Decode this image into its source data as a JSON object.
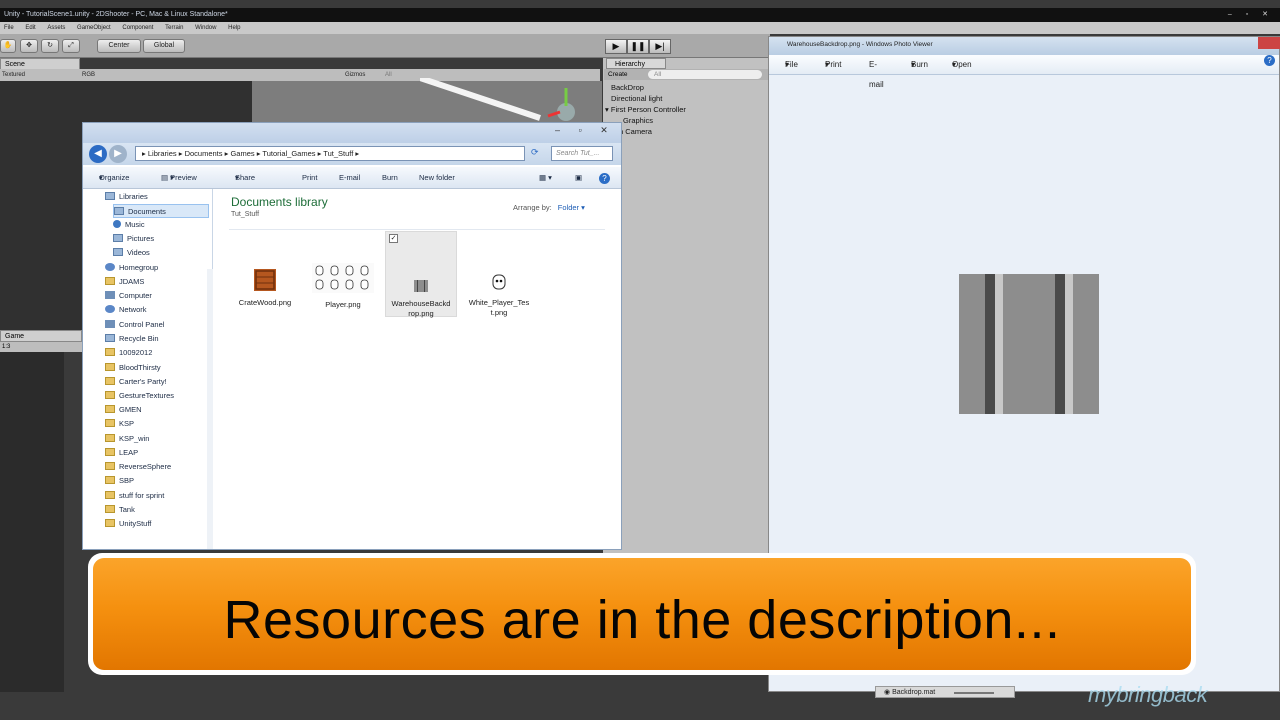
{
  "unity": {
    "title": "Unity - TutorialScene1.unity - 2DShooter - PC, Mac & Linux Standalone*",
    "menu": [
      "File",
      "Edit",
      "Assets",
      "GameObject",
      "Component",
      "Terrain",
      "Window",
      "Help"
    ],
    "toolbar": {
      "center_label": "Center",
      "global_label": "Global"
    },
    "scene_tab": "Scene",
    "scene_bar": {
      "render_mode": "Textured",
      "color_mode": "RGB",
      "gizmos": "Gizmos",
      "search": "All"
    },
    "game_tab": "Game",
    "game_aspect": "1:3",
    "hierarchy": {
      "tab": "Hierarchy",
      "create": "Create",
      "search": "All",
      "items": [
        "BackDrop",
        "Directional light",
        "First Person Controller",
        "Graphics",
        "n Camera"
      ]
    },
    "statusbar_item": "Backdrop.mat"
  },
  "explorer": {
    "breadcrumb": [
      "Libraries",
      "Documents",
      "Games",
      "Tutorial_Games",
      "Tut_Stuff"
    ],
    "search_placeholder": "Search Tut_...",
    "commands": [
      "Organize",
      "Preview",
      "Share with",
      "Print",
      "E-mail",
      "Burn",
      "New folder"
    ],
    "nav_items": [
      {
        "label": "Libraries",
        "icon": "library-icon"
      },
      {
        "label": "Documents",
        "icon": "library-icon"
      },
      {
        "label": "Music",
        "icon": "music-icon"
      },
      {
        "label": "Pictures",
        "icon": "library-icon"
      },
      {
        "label": "Videos",
        "icon": "library-icon"
      },
      {
        "label": "Homegroup",
        "icon": "homegroup-icon"
      },
      {
        "label": "JDAMS",
        "icon": "folder-icon"
      },
      {
        "label": "Computer",
        "icon": "computer-icon"
      },
      {
        "label": "Network",
        "icon": "network-icon"
      },
      {
        "label": "Control Panel",
        "icon": "control-panel-icon"
      },
      {
        "label": "Recycle Bin",
        "icon": "recycle-bin-icon"
      },
      {
        "label": "10092012",
        "icon": "folder-icon"
      },
      {
        "label": "BloodThirsty",
        "icon": "folder-icon"
      },
      {
        "label": "Carter's Party!",
        "icon": "folder-icon"
      },
      {
        "label": "GestureTextures",
        "icon": "folder-icon"
      },
      {
        "label": "GMEN",
        "icon": "folder-icon"
      },
      {
        "label": "KSP",
        "icon": "folder-icon"
      },
      {
        "label": "KSP_win",
        "icon": "folder-icon"
      },
      {
        "label": "LEAP",
        "icon": "folder-icon"
      },
      {
        "label": "ReverseSphere",
        "icon": "folder-icon"
      },
      {
        "label": "SBP",
        "icon": "folder-icon"
      },
      {
        "label": "stuff for sprint",
        "icon": "folder-icon"
      },
      {
        "label": "Tank",
        "icon": "folder-icon"
      },
      {
        "label": "UnityStuff",
        "icon": "folder-icon"
      }
    ],
    "library_title": "Documents library",
    "library_sub": "Tut_Stuff",
    "arrange_by_label": "Arrange by:",
    "arrange_by_value": "Folder",
    "files": [
      {
        "name": "CrateWood.png"
      },
      {
        "name": "Player.png"
      },
      {
        "name": "WarehouseBackdrop.png",
        "line1": "WarehouseBackd",
        "line2": "rop.png",
        "selected": true
      },
      {
        "name": "White_Player_Test.png",
        "line1": "White_Player_Tes",
        "line2": "t.png"
      }
    ]
  },
  "photo_viewer": {
    "title": "WarehouseBackdrop.png - Windows Photo Viewer",
    "menu": [
      "File",
      "Print",
      "E-mail",
      "Burn",
      "Open"
    ],
    "image": {
      "name": "WarehouseBackdrop.png"
    }
  },
  "banner": {
    "text": "Resources are in the description..."
  },
  "watermark": "mybringback",
  "colors": {
    "banner_orange": "#f5900f",
    "library_green": "#1d6d38",
    "unity_dark": "#3a3a3a"
  }
}
